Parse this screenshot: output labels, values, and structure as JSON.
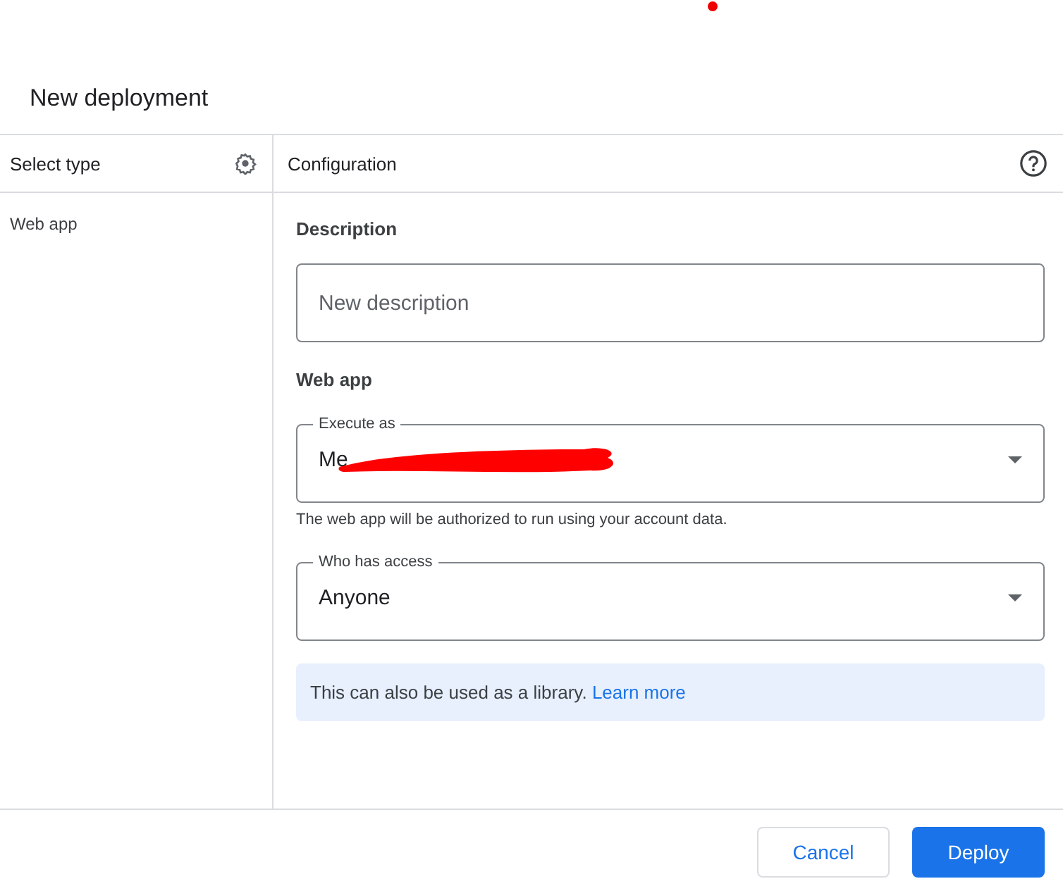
{
  "dialog": {
    "title": "New deployment"
  },
  "sidebar": {
    "heading": "Select type",
    "items": [
      {
        "label": "Web app",
        "selected": false
      }
    ]
  },
  "config": {
    "heading": "Configuration",
    "description": {
      "label": "Description",
      "placeholder": "New description"
    },
    "section": "Web app",
    "selects": [
      {
        "label": "Execute as",
        "value": "Me",
        "redacted": true,
        "hint": "The web app will be authorized to run using your account data."
      },
      {
        "label": "Who has access",
        "value": "Anyone",
        "redacted": false
      }
    ],
    "info": {
      "text": "This can also be used as a library.",
      "link": "Learn more"
    }
  },
  "buttons": [
    {
      "label": "Cancel",
      "kind": "secondary"
    },
    {
      "label": "Deploy",
      "kind": "primary"
    }
  ]
}
